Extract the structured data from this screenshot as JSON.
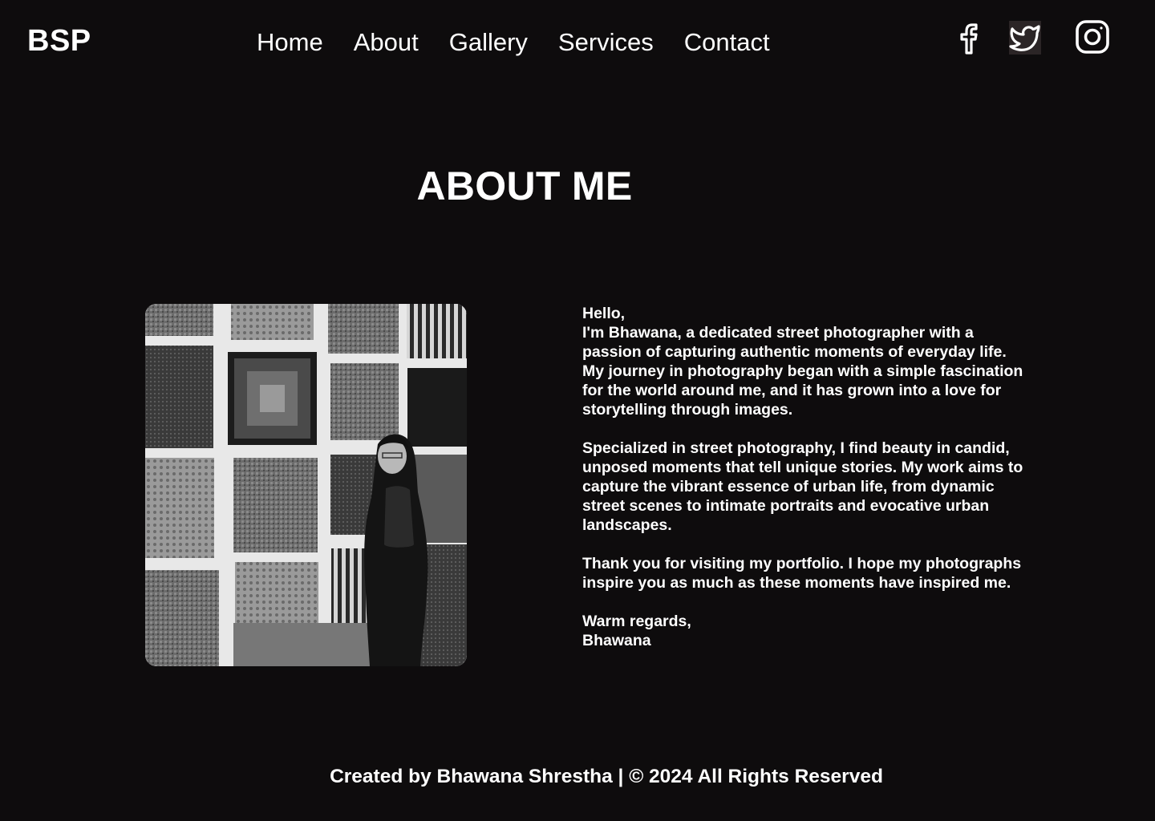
{
  "brand": {
    "logo": "BSP"
  },
  "nav": {
    "items": [
      {
        "label": "Home"
      },
      {
        "label": "About"
      },
      {
        "label": "Gallery"
      },
      {
        "label": "Services"
      },
      {
        "label": "Contact"
      }
    ]
  },
  "socials": [
    {
      "icon": "facebook-icon"
    },
    {
      "icon": "twitter-icon"
    },
    {
      "icon": "instagram-icon"
    }
  ],
  "about": {
    "title": "ABOUT ME",
    "greeting": "Hello,",
    "paragraph1": "I'm Bhawana, a dedicated street photographer with a passion of capturing authentic moments of everyday life. My journey in photography began with a simple fascination for the world around me, and it has grown into a love for storytelling through images.",
    "paragraph2": "Specialized in street photography, I find beauty in candid, unposed moments that tell unique stories. My work aims to capture the vibrant essence of urban life, from dynamic street scenes to intimate portraits and evocative urban landscapes.",
    "paragraph3": "Thank you for visiting my portfolio. I hope my photographs inspire you as much as these moments have inspired me.",
    "signoff": "Warm regards,",
    "signature": "Bhawana"
  },
  "footer": {
    "text": "Created by Bhawana Shrestha | © 2024 All Rights Reserved"
  },
  "colors": {
    "background": "#0e0c0d",
    "text": "#ffffff"
  }
}
